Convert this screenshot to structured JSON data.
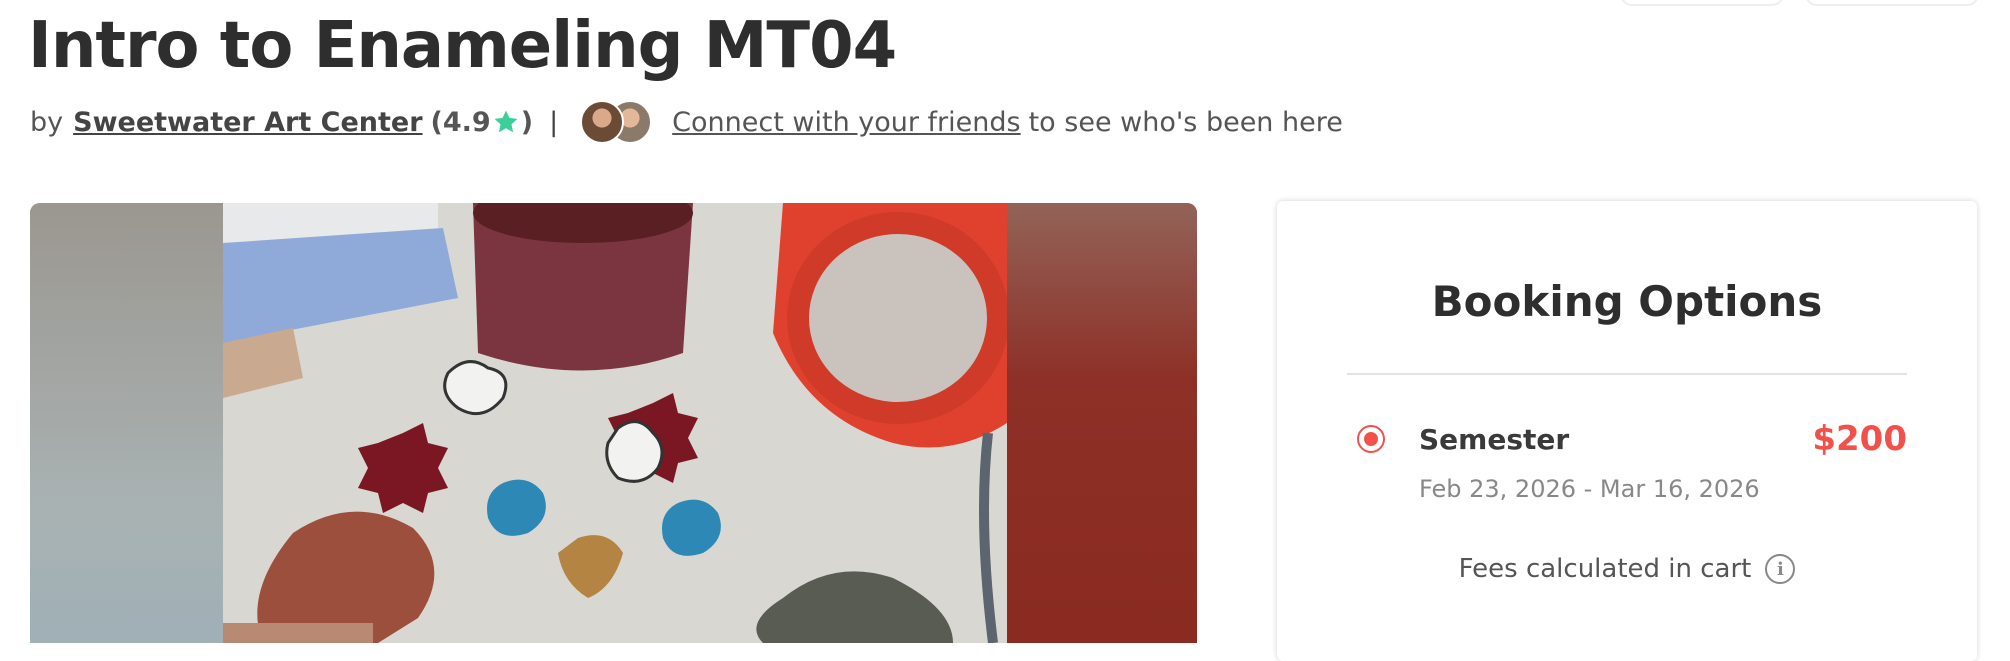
{
  "page": {
    "title": "Intro to Enameling MT04"
  },
  "byline": {
    "prefix": "by",
    "organizer": "Sweetwater Art Center",
    "rating_open": "(4.9",
    "rating_close": ")",
    "separator": "|",
    "connect_link": "Connect with your friends",
    "connect_suffix": "to see who's been here",
    "star_color": "#3ccf9b"
  },
  "booking": {
    "heading": "Booking Options",
    "option": {
      "name": "Semester",
      "price": "$200",
      "dates": "Feb 23, 2026 - Mar 16, 2026",
      "selected": true
    },
    "fees_text": "Fees calculated in cart",
    "accent_color": "#f0524b"
  },
  "icons": {
    "star": "star-icon",
    "info": "info-icon",
    "radio": "radio-selected-icon"
  }
}
